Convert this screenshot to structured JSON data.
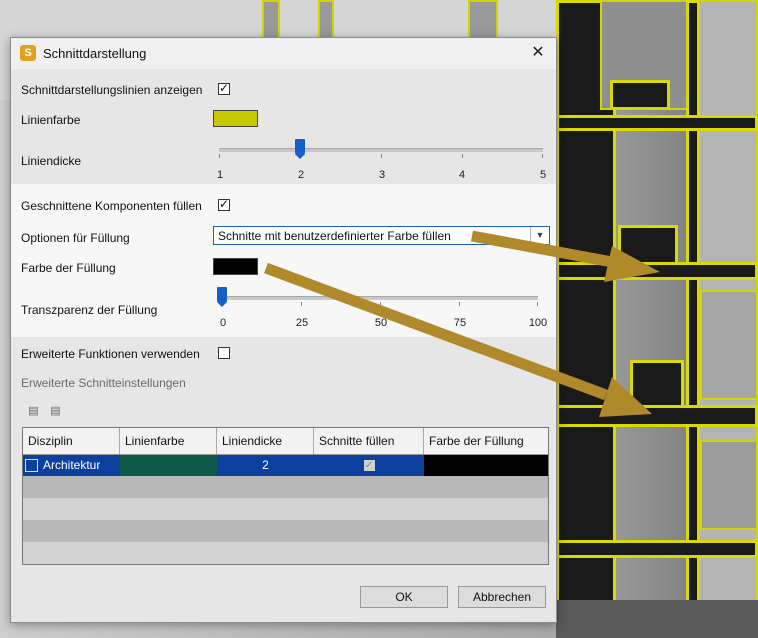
{
  "dialog": {
    "title": "Schnittdarstellung",
    "app_icon_letter": "S",
    "close_glyph": "✕"
  },
  "settings": {
    "show_lines_label": "Schnittdarstellungslinien anzeigen",
    "show_lines_checked": true,
    "line_color_label": "Linienfarbe",
    "line_color": "#c8c800",
    "line_thickness_label": "Liniendicke",
    "line_thickness_ticks": [
      "1",
      "2",
      "3",
      "4",
      "5"
    ],
    "line_thickness_value": 2,
    "fill_components_label": "Geschnittene Komponenten füllen",
    "fill_components_checked": true,
    "fill_options_label": "Optionen für Füllung",
    "fill_options_value": "Schnitte mit benutzerdefinierter Farbe füllen",
    "fill_color_label": "Farbe der Füllung",
    "fill_color": "#000000",
    "transparency_label": "Transzparenz der Füllung",
    "transparency_ticks": [
      "0",
      "25",
      "50",
      "75",
      "100"
    ],
    "transparency_value": 0,
    "advanced_label": "Erweiterte Funktionen verwenden",
    "advanced_checked": false,
    "advanced_section_label": "Erweiterte Schnitteinstellungen"
  },
  "table": {
    "columns": [
      "Disziplin",
      "Linienfarbe",
      "Liniendicke",
      "Schnitte füllen",
      "Farbe der Füllung"
    ],
    "rows": [
      {
        "discipline": "Architektur",
        "line_color": "#0e5a4a",
        "thickness": "2",
        "fill": true,
        "fill_color": "#000000"
      }
    ]
  },
  "buttons": {
    "ok": "OK",
    "cancel": "Abbrechen"
  },
  "colors": {
    "accent": "#1460c8",
    "selection": "#0d3f9e",
    "annotation_arrow": "#b08a2a",
    "outline_yellow": "#d9d900"
  }
}
